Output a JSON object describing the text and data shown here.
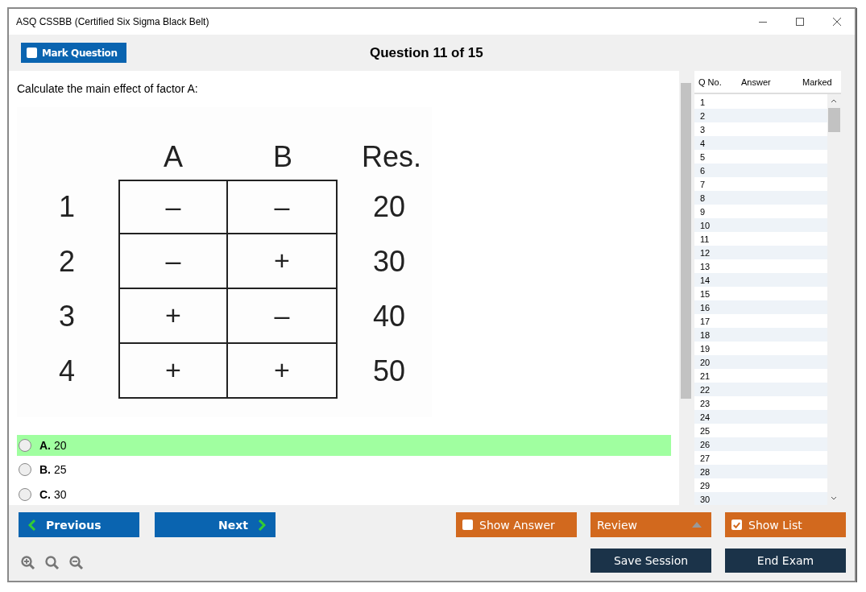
{
  "window": {
    "title": "ASQ CSSBB (Certified Six Sigma Black Belt)"
  },
  "toolbar": {
    "mark_question": {
      "label": "Mark Question",
      "checked": false
    },
    "counter": "Question 11 of 15"
  },
  "question": {
    "text": "Calculate the main effect of factor A:",
    "figure": {
      "columns": [
        "A",
        "B",
        "Res."
      ],
      "rows": [
        {
          "label": "1",
          "cells": [
            "–",
            "–",
            "20"
          ]
        },
        {
          "label": "2",
          "cells": [
            "–",
            "+",
            "30"
          ]
        },
        {
          "label": "3",
          "cells": [
            "+",
            "–",
            "40"
          ]
        },
        {
          "label": "4",
          "cells": [
            "+",
            "+",
            "50"
          ]
        }
      ]
    },
    "options": [
      {
        "letter": "A.",
        "text": "20",
        "highlighted": true,
        "selected": false
      },
      {
        "letter": "B.",
        "text": "25",
        "highlighted": false,
        "selected": false
      },
      {
        "letter": "C.",
        "text": "30",
        "highlighted": false,
        "selected": false
      }
    ]
  },
  "question_list": {
    "columns": [
      "Q No.",
      "Answer",
      "Marked"
    ],
    "rows": [
      "1",
      "2",
      "3",
      "4",
      "5",
      "6",
      "7",
      "8",
      "9",
      "10",
      "11",
      "12",
      "13",
      "14",
      "15",
      "16",
      "17",
      "18",
      "19",
      "20",
      "21",
      "22",
      "23",
      "24",
      "25",
      "26",
      "27",
      "28",
      "29",
      "30"
    ]
  },
  "footer": {
    "previous": "Previous",
    "next": "Next",
    "show_answer": {
      "label": "Show Answer",
      "checked": false
    },
    "review": "Review",
    "show_list": {
      "label": "Show List",
      "checked": true
    },
    "save_session": "Save Session",
    "end_exam": "End Exam"
  }
}
